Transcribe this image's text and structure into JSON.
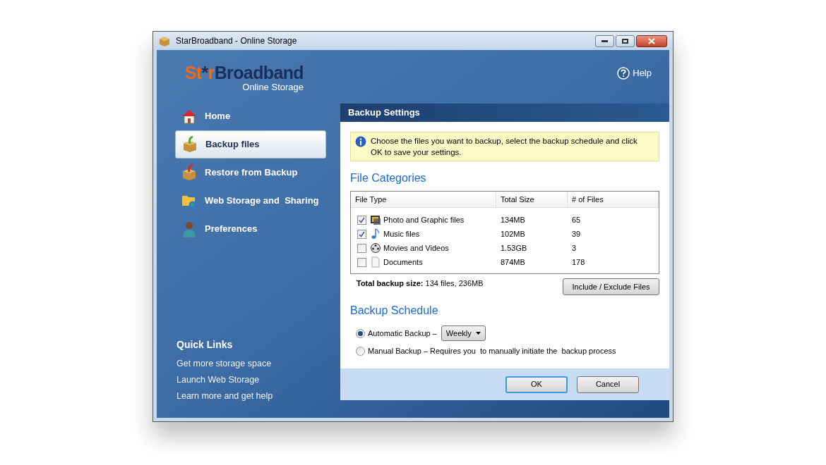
{
  "window": {
    "title": "StarBroadband - Online Storage"
  },
  "logo": {
    "segments": [
      {
        "text": "St",
        "color": "#f26a1b"
      },
      {
        "text": "*",
        "color": "#1c2f5c"
      },
      {
        "text": "r",
        "color": "#f26a1b"
      },
      {
        "text": "Broadband",
        "color": "#1c2f5c"
      }
    ],
    "subtitle": "Online Storage"
  },
  "help": {
    "label": "Help"
  },
  "sidebar": {
    "items": [
      {
        "label": "Home",
        "kind": "home",
        "selected": false
      },
      {
        "label": "Backup files",
        "kind": "backup",
        "selected": true
      },
      {
        "label": "Restore from Backup",
        "kind": "restore",
        "selected": false
      },
      {
        "label": "Web Storage and  Sharing",
        "kind": "web",
        "selected": false
      },
      {
        "label": "Preferences",
        "kind": "person",
        "selected": false
      }
    ]
  },
  "quick_links": {
    "title": "Quick Links",
    "links": [
      "Get more storage space",
      "Launch Web Storage",
      "Learn more and get help"
    ]
  },
  "panel": {
    "title": "Backup Settings",
    "info": "Choose the files you want to backup, select the backup schedule and click OK to save your settings.",
    "categories_heading": "File Categories",
    "table": {
      "columns": [
        "File Type",
        "Total Size",
        "# of Files"
      ],
      "rows": [
        {
          "checked": true,
          "kind": "photo",
          "name": "Photo and Graphic files",
          "size": "134MB",
          "count": "65"
        },
        {
          "checked": true,
          "kind": "music",
          "name": "Music files",
          "size": "102MB",
          "count": "39"
        },
        {
          "checked": false,
          "kind": "video",
          "name": "Movies and Videos",
          "size": "1.53GB",
          "count": "3"
        },
        {
          "checked": false,
          "kind": "document",
          "name": "Documents",
          "size": "874MB",
          "count": "178"
        }
      ]
    },
    "total": "**Total backup size:** 134 files, 236MB",
    "include_button": "Include / Exclude Files",
    "schedule_heading": "Backup Schedule",
    "schedule_options": [
      {
        "label": "Automatic Backup –",
        "selected": true,
        "dropdown": "Weekly"
      },
      {
        "label": "Manual Backup – Requires you  to manually initiate the  backup process",
        "selected": false
      }
    ],
    "buttons": [
      {
        "label": "OK",
        "default": true
      },
      {
        "label": "Cancel",
        "default": false
      }
    ]
  }
}
